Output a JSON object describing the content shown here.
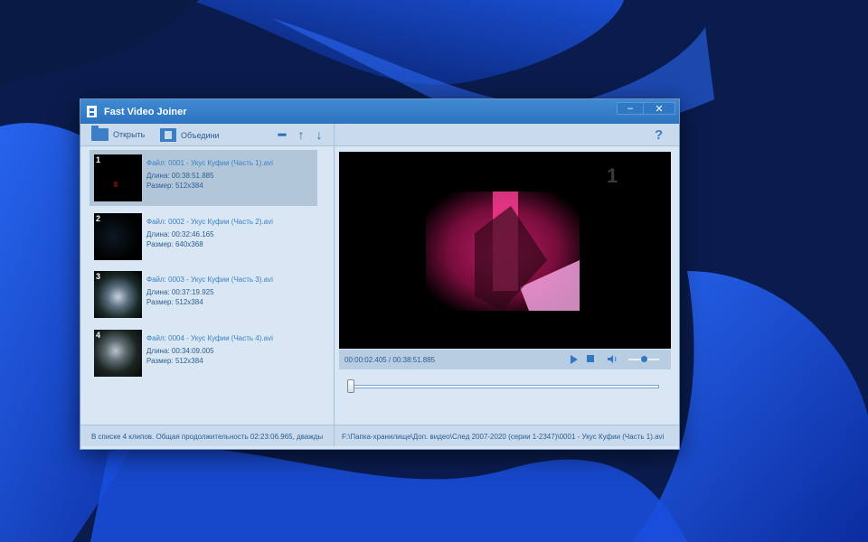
{
  "window": {
    "title": "Fast Video Joiner",
    "minimize_label": "–",
    "close_label": "✕"
  },
  "toolbar": {
    "open_label": "Открыть",
    "join_label": "Объедини",
    "remove_glyph": "━",
    "up_glyph": "↑",
    "down_glyph": "↓",
    "help_label": "?"
  },
  "clips": [
    {
      "num": "1",
      "file": "Файл: 0001 - Укус Куфии (Часть 1).avi",
      "duration": "Длина: 00:38:51.885",
      "size": "Размер: 512x384",
      "selected": true
    },
    {
      "num": "2",
      "file": "Файл: 0002 - Укус Куфии (Часть 2).avi",
      "duration": "Длина: 00:32:46.165",
      "size": "Размер: 640x368",
      "selected": false
    },
    {
      "num": "3",
      "file": "Файл: 0003 - Укус Куфии (Часть 3).avi",
      "duration": "Длина: 00:37:19.925",
      "size": "Размер: 512x384",
      "selected": false
    },
    {
      "num": "4",
      "file": "Файл: 0004 - Укус Куфии (Часть 4).avi",
      "duration": "Длина: 00:34:09.005",
      "size": "Размер: 512x384",
      "selected": false
    }
  ],
  "player": {
    "time": "00:00:02.405 / 00:38:51.885",
    "seek_fraction": 0.001,
    "volume_fraction": 0.5
  },
  "status": {
    "left": "В списке 4 клипов. Общая продолжительность 02:23:06.965, дважды",
    "right": "F:\\Папка-хранилище\\Доп. видео\\След 2007-2020 (серии 1-2347)\\0001 - Укус Куфии (Часть 1).avi"
  },
  "colors": {
    "titlebar": "#2c74c0",
    "accent": "#3b82c4",
    "panel": "#d9e6f3",
    "selected_row": "#b2c6da"
  }
}
